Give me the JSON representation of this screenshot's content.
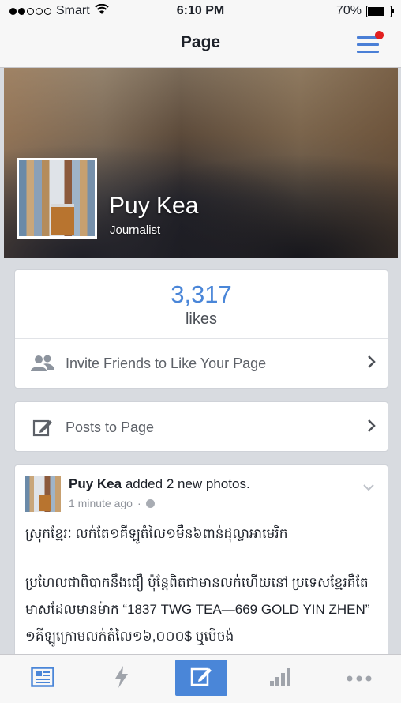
{
  "status_bar": {
    "carrier": "Smart",
    "time": "6:10 PM",
    "battery": "70%",
    "signal_bars_filled": 2,
    "battery_level": 0.7
  },
  "navbar": {
    "title": "Page",
    "menu_icon": "hamburger-menu-icon",
    "notification_color": "#e32020"
  },
  "profile": {
    "name": "Puy Kea",
    "category": "Journalist"
  },
  "likes": {
    "count": "3,317",
    "label": "likes",
    "invite_label": "Invite Friends to Like Your Page"
  },
  "posts": {
    "label": "Posts to Page"
  },
  "feed": {
    "author": "Puy Kea",
    "action": " added 2 new photos.",
    "time": "1 minute ago",
    "privacy_icon": "globe-icon",
    "text_line1": "ស្រុកខ្មែរៈ លក់តែ១គីឡូតំលៃ១មឺន៦ពាន់ដុល្លាអាមេរិក",
    "text_para2": "ប្រហែលជាពិបាកនឹងជឿ ប៉ុន្តែពិតជាមានលក់ហើយនៅ ប្រទេសខ្មែរគឺតែមាសដែលមានម៉ាក “1837 TWG TEA—669 GOLD YIN ZHEN” ១គីឡូក្រោមលក់តំលៃ១៦,០០០$ ឬបើចង់"
  },
  "tabbar": {
    "items": [
      {
        "icon": "news-feed-icon",
        "active": false
      },
      {
        "icon": "activity-bolt-icon",
        "active": false
      },
      {
        "icon": "compose-icon",
        "active": true
      },
      {
        "icon": "insights-chart-icon",
        "active": false
      },
      {
        "icon": "more-icon",
        "active": false
      }
    ]
  },
  "colors": {
    "accent": "#4a86d8",
    "background": "#d8dbe0"
  }
}
